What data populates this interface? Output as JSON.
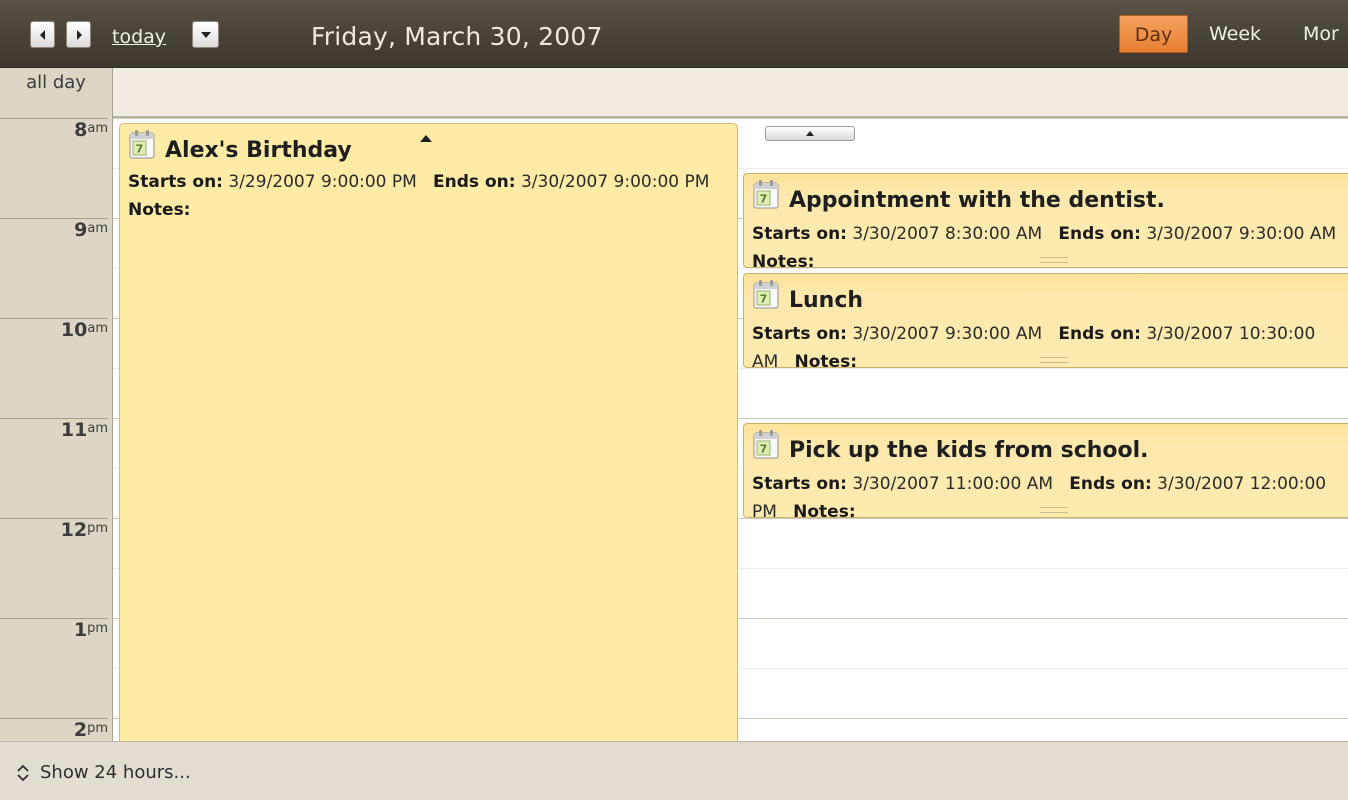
{
  "toolbar": {
    "prev_icon": "chevron-left-icon",
    "next_icon": "chevron-right-icon",
    "today_label": "today",
    "dropdown_icon": "chevron-down-icon",
    "date_title": "Friday, March 30, 2007",
    "views": [
      {
        "label": "Day",
        "active": true
      },
      {
        "label": "Week",
        "active": false
      },
      {
        "label": "Mor",
        "active": false
      }
    ]
  },
  "allday": {
    "label": "all day"
  },
  "hours": [
    {
      "num": "8",
      "suffix": "am"
    },
    {
      "num": "9",
      "suffix": "am"
    },
    {
      "num": "10",
      "suffix": "am"
    },
    {
      "num": "11",
      "suffix": "am"
    },
    {
      "num": "12",
      "suffix": "pm"
    },
    {
      "num": "1",
      "suffix": "pm"
    },
    {
      "num": "2",
      "suffix": "pm"
    }
  ],
  "appointments": [
    {
      "title": "Alex's Birthday",
      "icon_day": "7",
      "starts_label": "Starts on:",
      "starts_value": "3/29/2007 9:00:00 PM",
      "ends_label": "Ends on:",
      "ends_value": "3/30/2007 9:00:00 PM",
      "notes_label": "Notes:"
    },
    {
      "title": "Appointment with the dentist.",
      "icon_day": "7",
      "starts_label": "Starts on:",
      "starts_value": "3/30/2007 8:30:00 AM",
      "ends_label": "Ends on:",
      "ends_value": "3/30/2007 9:30:00 AM",
      "notes_label": "Notes:"
    },
    {
      "title": "Lunch",
      "icon_day": "7",
      "starts_label": "Starts on:",
      "starts_value": "3/30/2007 9:30:00 AM",
      "ends_label": "Ends on:",
      "ends_value": "3/30/2007 10:30:00 AM",
      "notes_label": "Notes:"
    },
    {
      "title": "Pick up the kids from school.",
      "icon_day": "7",
      "starts_label": "Starts on:",
      "starts_value": "3/30/2007 11:00:00 AM",
      "ends_label": "Ends on:",
      "ends_value": "3/30/2007 12:00:00 PM",
      "notes_label": "Notes:"
    }
  ],
  "footer": {
    "show24_label": "Show 24 hours...",
    "show24_icon": "expand-vertical-icon"
  },
  "colors": {
    "toolbar": "#4a4338",
    "active_view": "#e77f32",
    "appointment": "#fde9ad",
    "gutter": "#ddd6c6",
    "allday": "#f1ebe1"
  }
}
